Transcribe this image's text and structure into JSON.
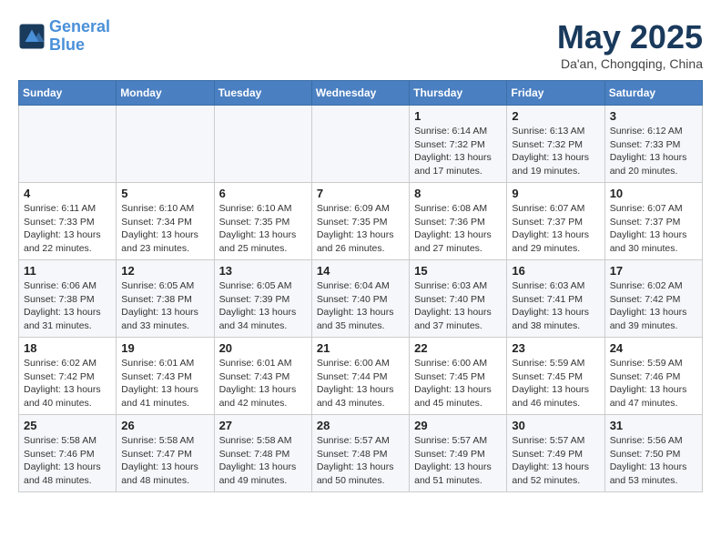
{
  "header": {
    "logo_line1": "General",
    "logo_line2": "Blue",
    "month": "May 2025",
    "location": "Da'an, Chongqing, China"
  },
  "weekdays": [
    "Sunday",
    "Monday",
    "Tuesday",
    "Wednesday",
    "Thursday",
    "Friday",
    "Saturday"
  ],
  "weeks": [
    [
      {
        "day": "",
        "info": ""
      },
      {
        "day": "",
        "info": ""
      },
      {
        "day": "",
        "info": ""
      },
      {
        "day": "",
        "info": ""
      },
      {
        "day": "1",
        "info": "Sunrise: 6:14 AM\nSunset: 7:32 PM\nDaylight: 13 hours\nand 17 minutes."
      },
      {
        "day": "2",
        "info": "Sunrise: 6:13 AM\nSunset: 7:32 PM\nDaylight: 13 hours\nand 19 minutes."
      },
      {
        "day": "3",
        "info": "Sunrise: 6:12 AM\nSunset: 7:33 PM\nDaylight: 13 hours\nand 20 minutes."
      }
    ],
    [
      {
        "day": "4",
        "info": "Sunrise: 6:11 AM\nSunset: 7:33 PM\nDaylight: 13 hours\nand 22 minutes."
      },
      {
        "day": "5",
        "info": "Sunrise: 6:10 AM\nSunset: 7:34 PM\nDaylight: 13 hours\nand 23 minutes."
      },
      {
        "day": "6",
        "info": "Sunrise: 6:10 AM\nSunset: 7:35 PM\nDaylight: 13 hours\nand 25 minutes."
      },
      {
        "day": "7",
        "info": "Sunrise: 6:09 AM\nSunset: 7:35 PM\nDaylight: 13 hours\nand 26 minutes."
      },
      {
        "day": "8",
        "info": "Sunrise: 6:08 AM\nSunset: 7:36 PM\nDaylight: 13 hours\nand 27 minutes."
      },
      {
        "day": "9",
        "info": "Sunrise: 6:07 AM\nSunset: 7:37 PM\nDaylight: 13 hours\nand 29 minutes."
      },
      {
        "day": "10",
        "info": "Sunrise: 6:07 AM\nSunset: 7:37 PM\nDaylight: 13 hours\nand 30 minutes."
      }
    ],
    [
      {
        "day": "11",
        "info": "Sunrise: 6:06 AM\nSunset: 7:38 PM\nDaylight: 13 hours\nand 31 minutes."
      },
      {
        "day": "12",
        "info": "Sunrise: 6:05 AM\nSunset: 7:38 PM\nDaylight: 13 hours\nand 33 minutes."
      },
      {
        "day": "13",
        "info": "Sunrise: 6:05 AM\nSunset: 7:39 PM\nDaylight: 13 hours\nand 34 minutes."
      },
      {
        "day": "14",
        "info": "Sunrise: 6:04 AM\nSunset: 7:40 PM\nDaylight: 13 hours\nand 35 minutes."
      },
      {
        "day": "15",
        "info": "Sunrise: 6:03 AM\nSunset: 7:40 PM\nDaylight: 13 hours\nand 37 minutes."
      },
      {
        "day": "16",
        "info": "Sunrise: 6:03 AM\nSunset: 7:41 PM\nDaylight: 13 hours\nand 38 minutes."
      },
      {
        "day": "17",
        "info": "Sunrise: 6:02 AM\nSunset: 7:42 PM\nDaylight: 13 hours\nand 39 minutes."
      }
    ],
    [
      {
        "day": "18",
        "info": "Sunrise: 6:02 AM\nSunset: 7:42 PM\nDaylight: 13 hours\nand 40 minutes."
      },
      {
        "day": "19",
        "info": "Sunrise: 6:01 AM\nSunset: 7:43 PM\nDaylight: 13 hours\nand 41 minutes."
      },
      {
        "day": "20",
        "info": "Sunrise: 6:01 AM\nSunset: 7:43 PM\nDaylight: 13 hours\nand 42 minutes."
      },
      {
        "day": "21",
        "info": "Sunrise: 6:00 AM\nSunset: 7:44 PM\nDaylight: 13 hours\nand 43 minutes."
      },
      {
        "day": "22",
        "info": "Sunrise: 6:00 AM\nSunset: 7:45 PM\nDaylight: 13 hours\nand 45 minutes."
      },
      {
        "day": "23",
        "info": "Sunrise: 5:59 AM\nSunset: 7:45 PM\nDaylight: 13 hours\nand 46 minutes."
      },
      {
        "day": "24",
        "info": "Sunrise: 5:59 AM\nSunset: 7:46 PM\nDaylight: 13 hours\nand 47 minutes."
      }
    ],
    [
      {
        "day": "25",
        "info": "Sunrise: 5:58 AM\nSunset: 7:46 PM\nDaylight: 13 hours\nand 48 minutes."
      },
      {
        "day": "26",
        "info": "Sunrise: 5:58 AM\nSunset: 7:47 PM\nDaylight: 13 hours\nand 48 minutes."
      },
      {
        "day": "27",
        "info": "Sunrise: 5:58 AM\nSunset: 7:48 PM\nDaylight: 13 hours\nand 49 minutes."
      },
      {
        "day": "28",
        "info": "Sunrise: 5:57 AM\nSunset: 7:48 PM\nDaylight: 13 hours\nand 50 minutes."
      },
      {
        "day": "29",
        "info": "Sunrise: 5:57 AM\nSunset: 7:49 PM\nDaylight: 13 hours\nand 51 minutes."
      },
      {
        "day": "30",
        "info": "Sunrise: 5:57 AM\nSunset: 7:49 PM\nDaylight: 13 hours\nand 52 minutes."
      },
      {
        "day": "31",
        "info": "Sunrise: 5:56 AM\nSunset: 7:50 PM\nDaylight: 13 hours\nand 53 minutes."
      }
    ]
  ]
}
